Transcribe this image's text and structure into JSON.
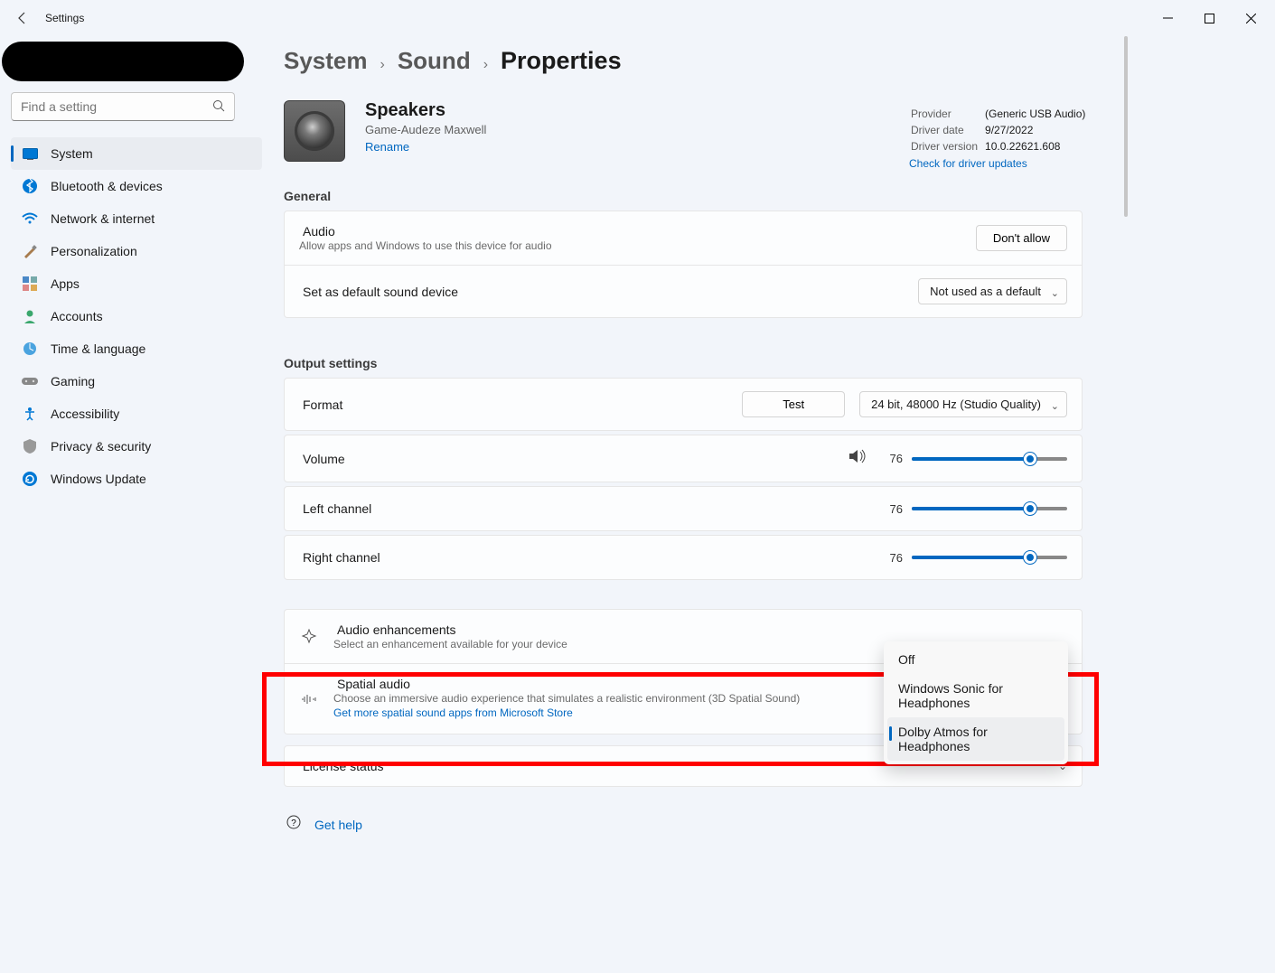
{
  "window": {
    "title": "Settings"
  },
  "search": {
    "placeholder": "Find a setting"
  },
  "nav": {
    "items": [
      {
        "label": "System"
      },
      {
        "label": "Bluetooth & devices"
      },
      {
        "label": "Network & internet"
      },
      {
        "label": "Personalization"
      },
      {
        "label": "Apps"
      },
      {
        "label": "Accounts"
      },
      {
        "label": "Time & language"
      },
      {
        "label": "Gaming"
      },
      {
        "label": "Accessibility"
      },
      {
        "label": "Privacy & security"
      },
      {
        "label": "Windows Update"
      }
    ]
  },
  "breadcrumb": {
    "a": "System",
    "b": "Sound",
    "c": "Properties"
  },
  "device": {
    "name": "Speakers",
    "sub": "Game-Audeze Maxwell",
    "rename": "Rename"
  },
  "driver": {
    "provider_label": "Provider",
    "provider_value": "(Generic USB Audio)",
    "date_label": "Driver date",
    "date_value": "9/27/2022",
    "version_label": "Driver version",
    "version_value": "10.0.22621.608",
    "update_link": "Check for driver updates"
  },
  "sections": {
    "general": "General",
    "output": "Output settings"
  },
  "audio_row": {
    "title": "Audio",
    "desc": "Allow apps and Windows to use this device for audio",
    "btn": "Don't allow"
  },
  "default_row": {
    "title": "Set as default sound device",
    "select": "Not used as a default"
  },
  "format_row": {
    "title": "Format",
    "test": "Test",
    "select": "24 bit, 48000 Hz (Studio Quality)"
  },
  "volume_row": {
    "title": "Volume",
    "value": "76"
  },
  "left_row": {
    "title": "Left channel",
    "value": "76"
  },
  "right_row": {
    "title": "Right channel",
    "value": "76"
  },
  "enhance_row": {
    "title": "Audio enhancements",
    "desc": "Select an enhancement available for your device"
  },
  "spatial_row": {
    "title": "Spatial audio",
    "desc": "Choose an immersive audio experience that simulates a realistic environment (3D Spatial Sound)",
    "link": "Get more spatial sound apps from Microsoft Store"
  },
  "spatial_options": {
    "off": "Off",
    "sonic": "Windows Sonic for Headphones",
    "dolby": "Dolby Atmos for Headphones"
  },
  "license_row": {
    "title": "License status"
  },
  "help": {
    "label": "Get help"
  }
}
